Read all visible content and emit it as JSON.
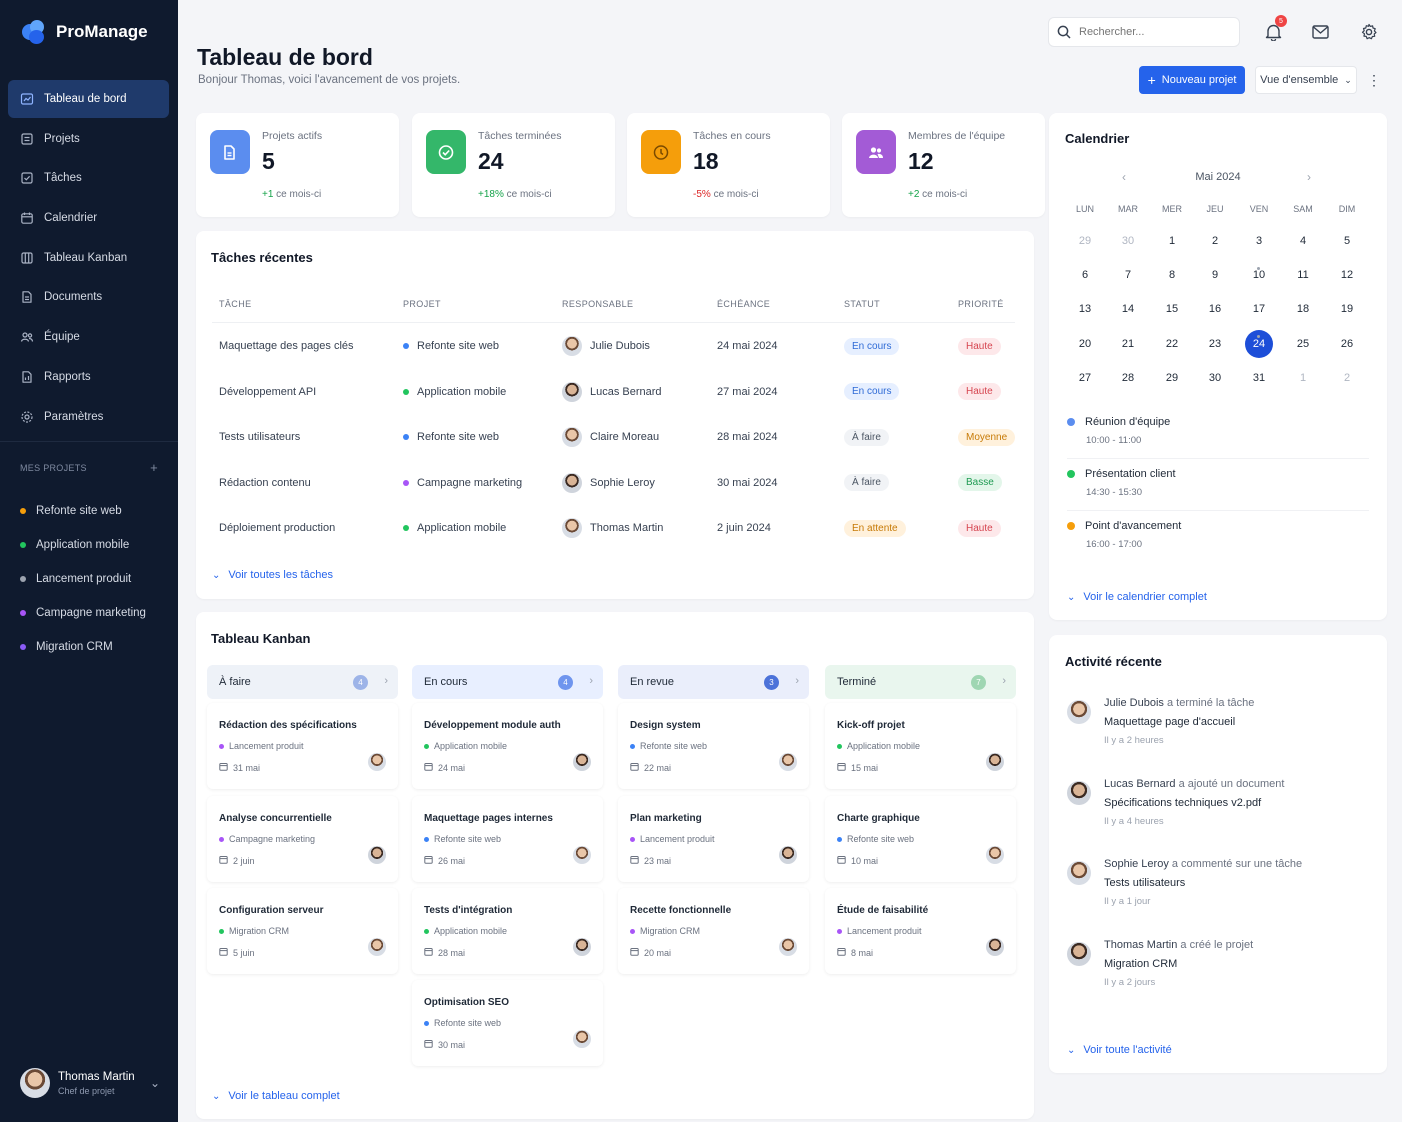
{
  "brand": {
    "name": "ProManage"
  },
  "nav": [
    {
      "label": "Tableau de bord",
      "icon": "dashboard-icon",
      "active": true
    },
    {
      "label": "Projets",
      "icon": "folder-icon"
    },
    {
      "label": "Tâches",
      "icon": "checklist-icon"
    },
    {
      "label": "Calendrier",
      "icon": "calendar-icon"
    },
    {
      "label": "Tableau Kanban",
      "icon": "kanban-icon"
    },
    {
      "label": "Documents",
      "icon": "document-icon"
    },
    {
      "label": "Équipe",
      "icon": "team-icon"
    },
    {
      "label": "Rapports",
      "icon": "report-icon"
    },
    {
      "label": "Paramètres",
      "icon": "gear-icon"
    }
  ],
  "projects_section": {
    "title": "MES PROJETS",
    "add": "+",
    "items": [
      {
        "label": "Refonte site web",
        "color": "#f59e0b"
      },
      {
        "label": "Application mobile",
        "color": "#22c55e"
      },
      {
        "label": "Lancement produit",
        "color": "#9ca3af"
      },
      {
        "label": "Campagne marketing",
        "color": "#a855f7"
      },
      {
        "label": "Migration CRM",
        "color": "#8b5cf6"
      }
    ]
  },
  "user": {
    "name": "Thomas Martin",
    "role": "Chef de projet"
  },
  "header": {
    "title": "Tableau de bord",
    "subtitle": "Bonjour Thomas, voici l'avancement de vos projets.",
    "search_placeholder": "Rechercher...",
    "notif_count": "5",
    "new_project": "Nouveau projet",
    "view_select": "Vue d'ensemble"
  },
  "stats": [
    {
      "label": "Projets actifs",
      "value": "5",
      "delta": "+1",
      "suffix": " ce mois-ci",
      "trend": "up",
      "color": "#5b8def",
      "bg": "#dbe7ff",
      "icon": "folder-icon"
    },
    {
      "label": "Tâches terminées",
      "value": "24",
      "delta": "+18%",
      "suffix": " ce mois-ci",
      "trend": "up",
      "color": "#34b76a",
      "bg": "#d9f4e4",
      "icon": "check-circle-icon"
    },
    {
      "label": "Tâches en cours",
      "value": "18",
      "delta": "-5%",
      "suffix": " ce mois-ci",
      "trend": "down",
      "color": "#f59e0b",
      "bg": "#fde9cf",
      "icon": "clock-icon"
    },
    {
      "label": "Membres de l'équipe",
      "value": "12",
      "delta": "+2",
      "suffix": " ce mois-ci",
      "trend": "up",
      "color": "#a35bd6",
      "bg": "#eddcfa",
      "icon": "users-icon"
    }
  ],
  "recent_tasks": {
    "title": "Tâches récentes",
    "columns": [
      "TÂCHE",
      "PROJET",
      "RESPONSABLE",
      "ÉCHÉANCE",
      "STATUT",
      "PRIORITÉ"
    ],
    "rows": [
      {
        "task": "Maquettage des pages clés",
        "project": "Refonte site web",
        "project_color": "#3b82f6",
        "owner": "Julie Dubois",
        "due": "24 mai 2024",
        "status": "En cours",
        "status_style": "blue",
        "priority": "Haute",
        "priority_style": "red"
      },
      {
        "task": "Développement API",
        "project": "Application mobile",
        "project_color": "#22c55e",
        "owner": "Lucas Bernard",
        "due": "27 mai 2024",
        "status": "En cours",
        "status_style": "blue",
        "priority": "Haute",
        "priority_style": "red"
      },
      {
        "task": "Tests utilisateurs",
        "project": "Refonte site web",
        "project_color": "#3b82f6",
        "owner": "Claire Moreau",
        "due": "28 mai 2024",
        "status": "À faire",
        "status_style": "gray",
        "priority": "Moyenne",
        "priority_style": "amber"
      },
      {
        "task": "Rédaction contenu",
        "project": "Campagne marketing",
        "project_color": "#a855f7",
        "owner": "Sophie Leroy",
        "due": "30 mai 2024",
        "status": "À faire",
        "status_style": "gray",
        "priority": "Basse",
        "priority_style": "green"
      },
      {
        "task": "Déploiement production",
        "project": "Application mobile",
        "project_color": "#22c55e",
        "owner": "Thomas Martin",
        "due": "2 juin 2024",
        "status": "En attente",
        "status_style": "amber",
        "priority": "Haute",
        "priority_style": "red"
      }
    ],
    "link": "Voir toutes les tâches"
  },
  "kanban": {
    "title": "Tableau Kanban",
    "link": "Voir le tableau complet",
    "columns": [
      {
        "name": "À faire",
        "count": "4",
        "head_bg": "#eef2f8",
        "count_bg": "#9db4e8",
        "cards": [
          {
            "title": "Rédaction des spécifications",
            "project": "Lancement produit",
            "color": "#a855f7",
            "date": "31 mai"
          },
          {
            "title": "Analyse concurrentielle",
            "project": "Campagne marketing",
            "color": "#a855f7",
            "date": "2 juin"
          },
          {
            "title": "Configuration serveur",
            "project": "Migration CRM",
            "color": "#22c55e",
            "date": "5 juin"
          }
        ]
      },
      {
        "name": "En cours",
        "count": "4",
        "head_bg": "#e8efff",
        "count_bg": "#6f95ee",
        "cards": [
          {
            "title": "Développement module auth",
            "project": "Application mobile",
            "color": "#22c55e",
            "date": "24 mai"
          },
          {
            "title": "Maquettage pages internes",
            "project": "Refonte site web",
            "color": "#3b82f6",
            "date": "26 mai"
          },
          {
            "title": "Tests d'intégration",
            "project": "Application mobile",
            "color": "#22c55e",
            "date": "28 mai"
          },
          {
            "title": "Optimisation SEO",
            "project": "Refonte site web",
            "color": "#3b82f6",
            "date": "30 mai"
          }
        ]
      },
      {
        "name": "En revue",
        "count": "3",
        "head_bg": "#eaeefb",
        "count_bg": "#4c72d9",
        "cards": [
          {
            "title": "Design system",
            "project": "Refonte site web",
            "color": "#3b82f6",
            "date": "22 mai"
          },
          {
            "title": "Plan marketing",
            "project": "Lancement produit",
            "color": "#a855f7",
            "date": "23 mai"
          },
          {
            "title": "Recette fonctionnelle",
            "project": "Migration CRM",
            "color": "#a855f7",
            "date": "20 mai"
          }
        ]
      },
      {
        "name": "Terminé",
        "count": "7",
        "head_bg": "#e9f6ee",
        "count_bg": "#9fd6b2",
        "cards": [
          {
            "title": "Kick-off projet",
            "project": "Application mobile",
            "color": "#22c55e",
            "date": "15 mai"
          },
          {
            "title": "Charte graphique",
            "project": "Refonte site web",
            "color": "#3b82f6",
            "date": "10 mai"
          },
          {
            "title": "Étude de faisabilité",
            "project": "Lancement produit",
            "color": "#a855f7",
            "date": "8 mai"
          }
        ]
      }
    ]
  },
  "calendar": {
    "title": "Calendrier",
    "month": "Mai 2024",
    "dow": [
      "LUN",
      "MAR",
      "MER",
      "JEU",
      "VEN",
      "SAM",
      "DIM"
    ],
    "weeks": [
      [
        "29",
        "30",
        "1",
        "2",
        "3",
        "4",
        "5"
      ],
      [
        "6",
        "7",
        "8",
        "9",
        "10",
        "11",
        "12"
      ],
      [
        "13",
        "14",
        "15",
        "16",
        "17",
        "18",
        "19"
      ],
      [
        "20",
        "21",
        "22",
        "23",
        "24",
        "25",
        "26"
      ],
      [
        "27",
        "28",
        "29",
        "30",
        "31",
        "1",
        "2"
      ]
    ],
    "selected": "24",
    "events": [
      {
        "title": "Réunion d'équipe",
        "time": "10:00 - 11:00",
        "color": "#5b8def"
      },
      {
        "title": "Présentation client",
        "time": "14:30 - 15:30",
        "color": "#22c55e"
      },
      {
        "title": "Point d'avancement",
        "time": "16:00 - 17:00",
        "color": "#f59e0b"
      }
    ],
    "link": "Voir le calendrier complet"
  },
  "activity": {
    "title": "Activité récente",
    "items": [
      {
        "who": "Julie Dubois",
        "action": " a terminé la tâche",
        "target": "Maquettage page d'accueil",
        "when": "Il y a 2 heures"
      },
      {
        "who": "Lucas Bernard",
        "action": " a ajouté un document",
        "target": "Spécifications techniques v2.pdf",
        "when": "Il y a 4 heures"
      },
      {
        "who": "Sophie Leroy",
        "action": " a commenté sur une tâche",
        "target": "Tests utilisateurs",
        "when": "Il y a 1 jour"
      },
      {
        "who": "Thomas Martin",
        "action": " a créé le projet",
        "target": "Migration CRM",
        "when": "Il y a 2 jours"
      }
    ],
    "link": "Voir toute l'activité"
  }
}
